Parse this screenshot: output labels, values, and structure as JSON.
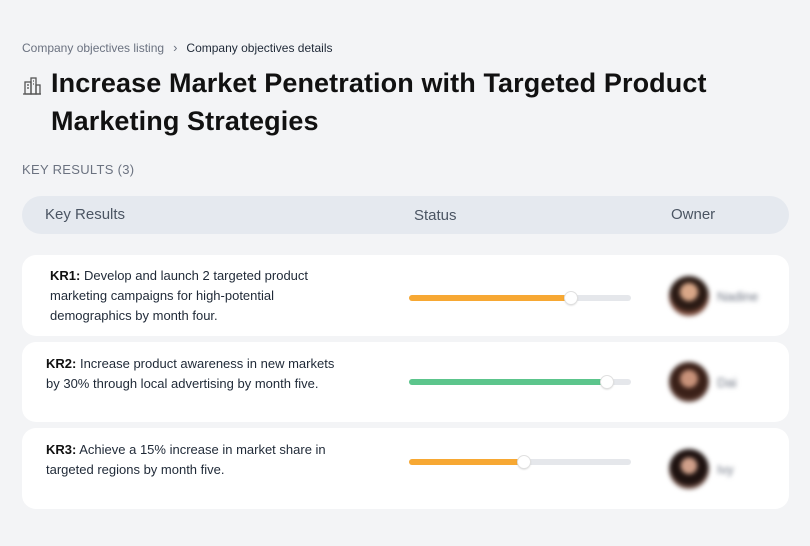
{
  "breadcrumb": {
    "parent": "Company objectives listing",
    "separator": "›",
    "current": "Company objectives details"
  },
  "objective": {
    "title": "Increase Market Penetration with Targeted Product Marketing Strategies",
    "icon": "building-icon"
  },
  "key_results_label": "KEY RESULTS (3)",
  "table": {
    "columns": [
      "Key Results",
      "Status",
      "Owner"
    ]
  },
  "key_results": [
    {
      "id": "KR1:",
      "text": "Develop and launch 2 targeted product marketing campaigns for high-potential demographics by month four.",
      "progress": 0.73,
      "color": "#f7a833",
      "owner": "Nadine"
    },
    {
      "id": "KR2:",
      "text": "Increase product awareness in new markets by 30% through local advertising by month five.",
      "progress": 0.89,
      "color": "#5cc58c",
      "owner": "Dai"
    },
    {
      "id": "KR3:",
      "text": "Achieve a 15% increase in market share in targeted regions by month five.",
      "progress": 0.52,
      "color": "#f7a833",
      "owner": "Ivy"
    }
  ]
}
